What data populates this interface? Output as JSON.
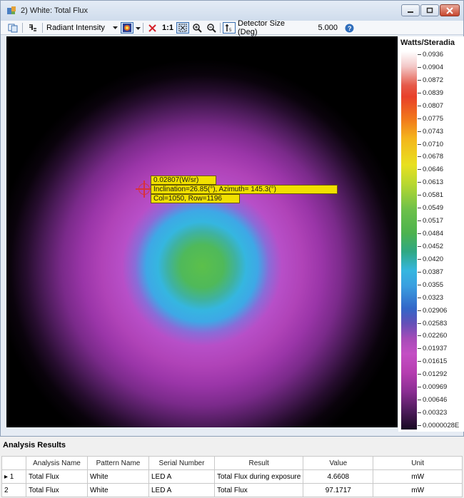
{
  "window": {
    "title": "2) White: Total Flux",
    "minimize_label": "—",
    "maximize_label": "□",
    "close_label": "✕"
  },
  "toolbar": {
    "measure_select": "Radiant Intensity",
    "one_to_one_label": "1:1",
    "detector_size_label": "Detector Size (Deg)",
    "detector_size_value": "5.000",
    "icons": [
      "copy-icon",
      "properties-icon",
      "dropdown-arrow-icon",
      "color-map-icon",
      "delete-icon",
      "fit-icon",
      "zoom-in-icon",
      "zoom-out-icon",
      "detector-icon",
      "help-icon"
    ]
  },
  "plot": {
    "tooltip_value": "0.02807(W/sr)",
    "tooltip_angles": "Inclination=26.85(°), Azimuth= 145.3(°)",
    "tooltip_position": "Col=1050, Row=1196"
  },
  "legend": {
    "title": "Watts/Steradia",
    "ticks": [
      "0.0936",
      "0.0904",
      "0.0872",
      "0.0839",
      "0.0807",
      "0.0775",
      "0.0743",
      "0.0710",
      "0.0678",
      "0.0646",
      "0.0613",
      "0.0581",
      "0.0549",
      "0.0517",
      "0.0484",
      "0.0452",
      "0.0420",
      "0.0387",
      "0.0355",
      "0.0323",
      "0.02906",
      "0.02583",
      "0.02260",
      "0.01937",
      "0.01615",
      "0.01292",
      "0.00969",
      "0.00646",
      "0.00323",
      "0.0000028E"
    ]
  },
  "results": {
    "title": "Analysis Results",
    "columns": [
      "",
      "Analysis Name",
      "Pattern Name",
      "Serial Number",
      "Result",
      "Value",
      "Unit"
    ],
    "rows": [
      {
        "index": "▸ 1",
        "analysis": "Total Flux",
        "pattern": "White",
        "serial": "LED A",
        "result": "Total Flux during exposure",
        "value": "4.6608",
        "unit": "mW"
      },
      {
        "index": "2",
        "analysis": "Total Flux",
        "pattern": "White",
        "serial": "LED A",
        "result": "Total Flux",
        "value": "97.1717",
        "unit": "mW"
      }
    ]
  }
}
